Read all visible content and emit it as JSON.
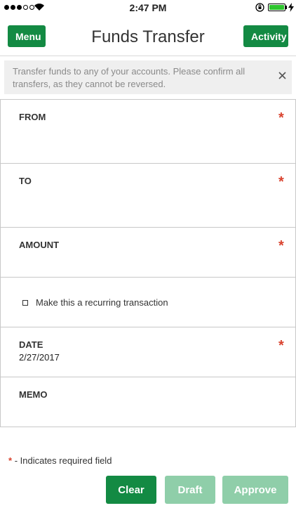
{
  "status_bar": {
    "time": "2:47 PM",
    "signal_bars": 3,
    "signal_total": 5,
    "battery_level": 1.0,
    "battery_color": "#2ec52e"
  },
  "header": {
    "menu_label": "Menu",
    "title": "Funds Transfer",
    "activity_label": "Activity",
    "accent_color": "#138a43"
  },
  "info": {
    "text": "Transfer funds to any of your accounts. Please confirm all transfers, as they cannot be reversed.",
    "close_icon": "close-icon"
  },
  "form": {
    "from": {
      "label": "FROM",
      "required": "*",
      "value": ""
    },
    "to": {
      "label": "TO",
      "required": "*",
      "value": ""
    },
    "amount": {
      "label": "AMOUNT",
      "required": "*",
      "value": ""
    },
    "recurring": {
      "label": "Make this a recurring transaction",
      "checked": false
    },
    "date": {
      "label": "DATE",
      "required": "*",
      "value": "2/27/2017"
    },
    "memo": {
      "label": "MEMO",
      "value": ""
    }
  },
  "footer": {
    "required_star": "*",
    "required_note": "- Indicates required field",
    "clear_label": "Clear",
    "draft_label": "Draft",
    "approve_label": "Approve",
    "required_color": "#d9432f"
  }
}
